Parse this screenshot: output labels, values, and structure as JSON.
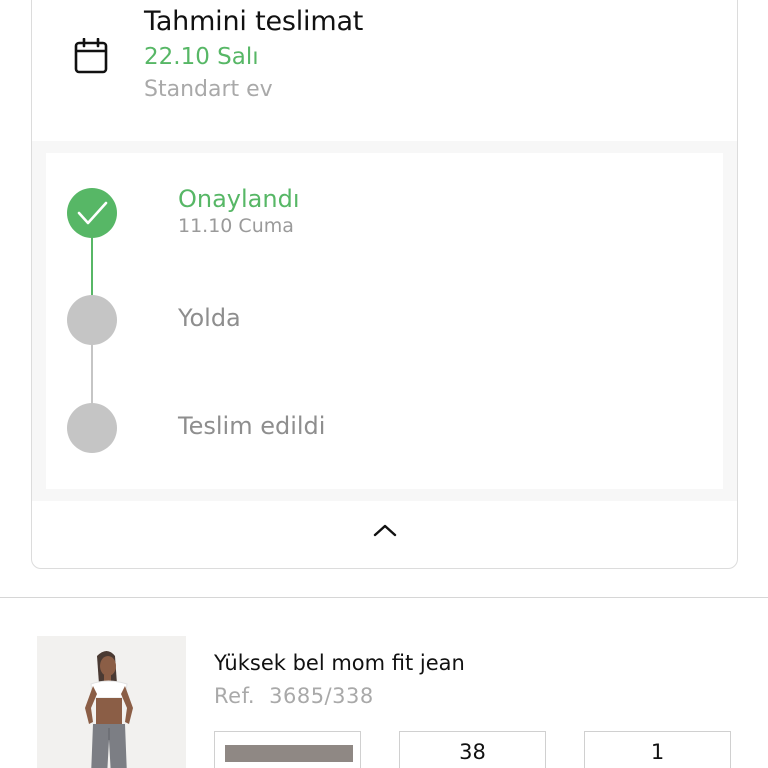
{
  "delivery": {
    "title": "Tahmini teslimat",
    "date": "22.10 Salı",
    "method": "Standart ev"
  },
  "steps": [
    {
      "label": "Onaylandı",
      "date": "11.10 Cuma",
      "status": "done"
    },
    {
      "label": "Yolda",
      "status": "pending"
    },
    {
      "label": "Teslim edildi",
      "status": "pending"
    }
  ],
  "colors": {
    "accent": "#57b766",
    "pending": "#c5c5c5",
    "swatch": "#8f8884"
  },
  "icons": {
    "calendar": "calendar-icon",
    "collapse": "chevron-up-icon",
    "check": "check-icon"
  },
  "product": {
    "name": "Yüksek bel mom fit jean",
    "ref_label": "Ref.",
    "ref_number": "3685/338",
    "color": "#8f8884",
    "size": "38",
    "quantity": "1"
  }
}
